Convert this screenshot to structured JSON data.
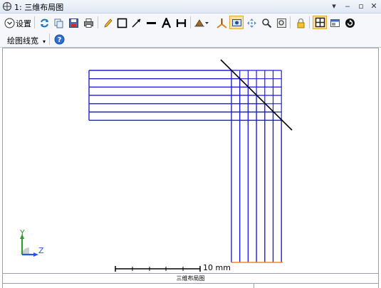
{
  "window": {
    "title": "1: 三维布局图"
  },
  "toolbar": {
    "settings_label": "设置",
    "line_width_label": "绘图线宽"
  },
  "canvas": {
    "scale_bar_label": "10 mm",
    "axis_y_label": "Y",
    "axis_z_label": "Z"
  },
  "status": {
    "caption": "三维布局图"
  },
  "colors": {
    "rays": "#1f1fd6",
    "mirror": "#000000",
    "focal_line": "#f08a24",
    "axis_y": "#2a9d2a",
    "axis_z": "#2a55e0"
  }
}
